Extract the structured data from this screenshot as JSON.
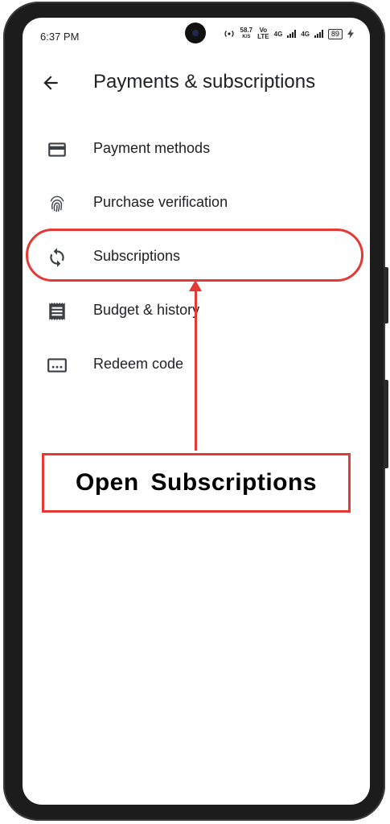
{
  "status_bar": {
    "time": "6:37 PM",
    "speed_value": "58.7",
    "speed_unit": "K/S",
    "vo_top": "Vo",
    "vo_bottom": "LTE",
    "net1": "4G",
    "net2": "4G",
    "battery": "89"
  },
  "header": {
    "title": "Payments & subscriptions"
  },
  "menu": {
    "items": [
      {
        "label": "Payment methods",
        "icon": "credit-card-icon"
      },
      {
        "label": "Purchase verification",
        "icon": "fingerprint-icon"
      },
      {
        "label": "Subscriptions",
        "icon": "sync-icon"
      },
      {
        "label": "Budget & history",
        "icon": "receipt-icon"
      },
      {
        "label": "Redeem code",
        "icon": "redeem-code-icon"
      }
    ]
  },
  "annotation": {
    "text": "Open  Subscriptions",
    "color": "#e53935"
  }
}
